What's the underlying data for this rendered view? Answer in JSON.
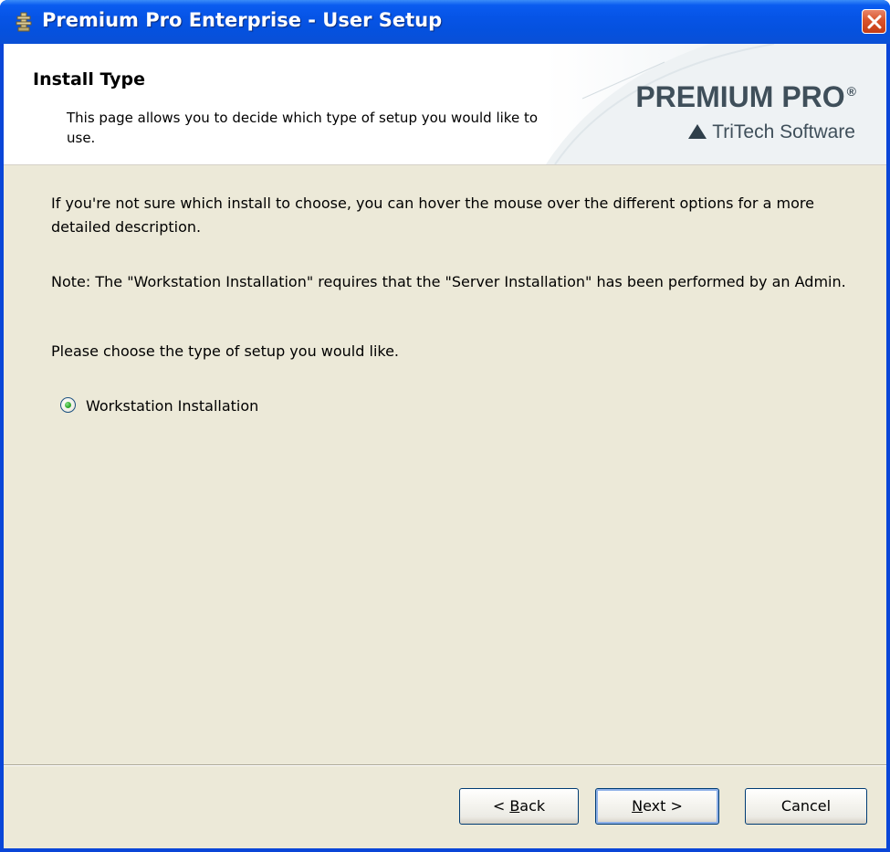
{
  "window": {
    "title": "Premium Pro Enterprise - User Setup",
    "icons": {
      "app": "installer-icon",
      "close": "close-icon"
    }
  },
  "header": {
    "title": "Install Type",
    "description": "This page allows you to decide which type of setup you would like to use.",
    "logo": {
      "main": "PREMIUM PRO",
      "registered": "®",
      "sub": "TriTech Software"
    }
  },
  "content": {
    "paragraph1": "If you're not sure which install to choose, you can hover the mouse over the different options for a more detailed description.",
    "paragraph2": "Note: The \"Workstation Installation\" requires that the \"Server Installation\" has been performed by an Admin.",
    "paragraph3": "Please choose the type of setup you would like.",
    "option": {
      "label": "Workstation Installation",
      "selected": true
    }
  },
  "buttons": {
    "back": {
      "prefix": "< ",
      "mnemonic": "B",
      "rest": "ack"
    },
    "next": {
      "mnemonic": "N",
      "rest": "ext >"
    },
    "cancel": "Cancel"
  },
  "colors": {
    "titlebar": "#0654e6",
    "dialog_bg": "#ece9d8",
    "close_button": "#d9532b",
    "logo_text": "#3f4f5a",
    "radio_dot": "#35b030"
  }
}
